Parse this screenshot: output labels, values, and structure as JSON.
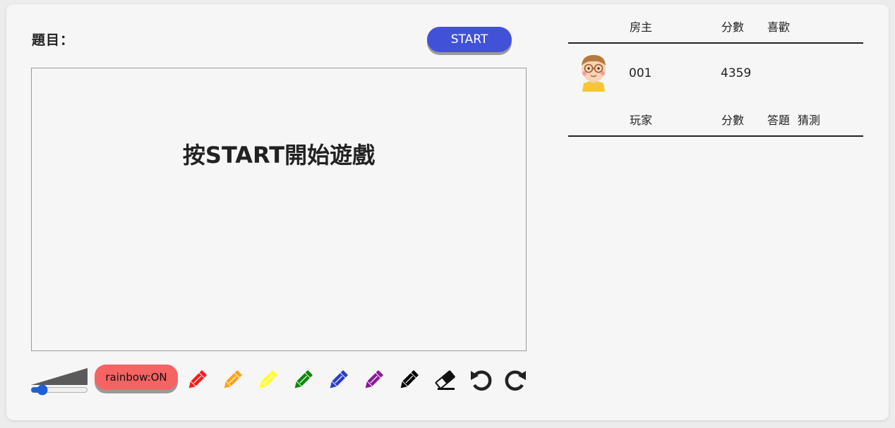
{
  "question": {
    "label": "題目："
  },
  "start_button": {
    "label": "START"
  },
  "canvas": {
    "message": "按START開始遊戲"
  },
  "toolbar": {
    "brush_size": 5,
    "rainbow_label": "rainbow:ON",
    "pens": [
      {
        "name": "red-pencil-icon",
        "color": "#ff1a1a"
      },
      {
        "name": "orange-pencil-icon",
        "color": "#ffa21a"
      },
      {
        "name": "yellow-pencil-icon",
        "color": "#ffff26"
      },
      {
        "name": "green-pencil-icon",
        "color": "#0a8a0a"
      },
      {
        "name": "blue-pencil-icon",
        "color": "#2b3ec6"
      },
      {
        "name": "purple-pencil-icon",
        "color": "#8a1a9a"
      },
      {
        "name": "black-pencil-icon",
        "color": "#000000"
      }
    ],
    "icons": [
      "eraser-icon",
      "undo-icon",
      "redo-icon"
    ]
  },
  "host_table": {
    "headers": [
      "房主",
      "分數",
      "喜歡"
    ],
    "rows": [
      {
        "avatar": "avatar-icon",
        "name": "001",
        "score": "4359",
        "likes": ""
      }
    ]
  },
  "player_table": {
    "headers": [
      "玩家",
      "分數",
      "答題",
      "猜測"
    ],
    "rows": []
  }
}
